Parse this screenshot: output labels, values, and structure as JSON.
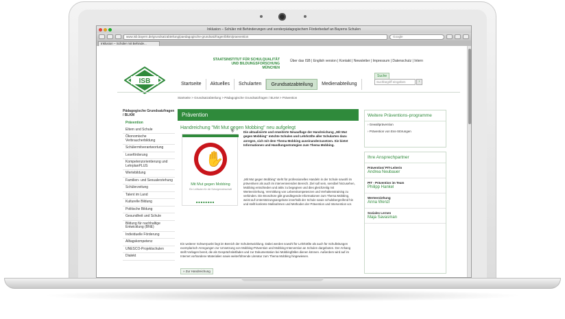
{
  "browser": {
    "window_title": "Inklusion – Schüler mit Behinderungen und sonderpädagogischem Förderbedarf an Bayerns Schulen",
    "url": "www.isb.bayern.de/grundsatzabteilung/paedagogische-grundsatzfragen/blkm/praevention",
    "search_placeholder": "Google",
    "tab_label": "Inklusion – Schüler mit Behinde..."
  },
  "header": {
    "logo_text": "ISB",
    "institute_name": [
      "STAATSINSTITUT FÜR SCHULQUALITÄT",
      "UND BILDUNGSFORSCHUNG",
      "MÜNCHEN"
    ],
    "topnav": "Über das ISB | English version | Kontakt | Newsletter | Impressum | Datenschutz | Intern",
    "mainnav": [
      "Startseite",
      "Aktuelles",
      "Schularten",
      "Grundsatzabteilung",
      "Medienabteilung"
    ],
    "active_nav": "Grundsatzabteilung",
    "search_label": "Suche",
    "search_placeholder": "Suchbegriff eingeben",
    "search_go": "›"
  },
  "breadcrumb": "Startseite > Grundsatzabteilung > Pädagogische Grundsatzfragen / BLKM > Prävention",
  "leftnav": {
    "heading": "Pädagogische Grundsatzfragen / BLKM",
    "items": [
      "Prävention",
      "Eltern und Schule",
      "Ökonomische Verbraucherbildung",
      "Schülermitverantwortung",
      "Leseförderung",
      "Kompetenzorientierung und LehrplanPLUS",
      "Wertebildung",
      "Familien- und Sexualerziehung",
      "Schülerzeitung",
      "Talent im Land",
      "Kulturelle Bildung",
      "Politische Bildung",
      "Gesundheit und Schule",
      "Bildung für nachhaltige Entwicklung (BNE)",
      "Individuelle Förderung",
      "Alltagskompetenz",
      "UNESCO-Projektschulen",
      "Dialekt"
    ]
  },
  "content": {
    "section_title": "Prävention",
    "headline": "Handreichung \"Mit Mut gegen Mobbing\" neu aufgelegt",
    "book_title": "Mit Mut gegen Mobbing",
    "book_subtitle": "Ein Leitfaden für die Schulgemeinschaft",
    "intro": "Die aktualisierte und erweiterte Neuauflage der Handreichung „Mit Mut gegen Mobbing“ möchte Schulen und Lehrkräfte aller Schularten dazu anregen, sich mit dem Thema Mobbing auseinanderzusetzen. Sie bietet Informationen und Handlungsstrategien zum Thema Mobbing.",
    "body1": "„Mit Mut gegen Mobbing“ steht für professionelles Handeln in der Schule sowohl im präventiven als auch im intervenierenden Bereich. Ziel soll sein, sensibel hinzusehen, Mobbing entschieden und aktiv zu begegnen und dies gleichzeitig mit Werteerziehung, Vermittlung von Lebenskompetenzen und Verhaltenstraining zu verbinden. Die Broschüre gibt grundlegende Informationen zum Thema Mobbing, weist auf Unterstützungsangebote innerhalb der Schule sowie schulübergreifend hin und stellt konkrete Maßnahmen und Methoden der Prävention und Intervention vor.",
    "body2": "Ein weiterer Schwerpunkt liegt im Bereich der Schulentwicklung. Dabei werden sowohl für Lehrkräfte als auch für Schulleitungen exemplarisch Anregungen zur Umsetzung von Mobbing-Prävention und Mobbing-Intervention an Schulen dargeboten. Der Anhang stellt Vorlagen bereit, die als Gesprächsleitfaden und zur Dokumentation bei Mobbingfällen dienen können. Außerdem wird auf im Internet vorhandene Materialien sowie weiterführende Literatur zum Thema Mobbing hingewiesen.",
    "more_link": "» Zur Handreichung"
  },
  "sidebar": {
    "box1_title": "Weitere Präventions-programme",
    "box1_links": [
      "› Gewaltprävention",
      "› Prävention von Ess-Störungen"
    ],
    "box2_title": "Ihre Ansprechpartner",
    "contacts": [
      {
        "role": "Prävention/ PIT-Leiterin",
        "name": "Andrea Neubauer"
      },
      {
        "role": "PIT - Prävention im Team",
        "name": "Philipp Hankel"
      },
      {
        "role": "Werteerziehung",
        "name": "Anna Wenzl"
      },
      {
        "role": "Soziales Lernen",
        "name": "Maja Savasman"
      }
    ]
  },
  "colors": {
    "accent": "#2f8a3b",
    "stop_sign": "#c8151b"
  }
}
